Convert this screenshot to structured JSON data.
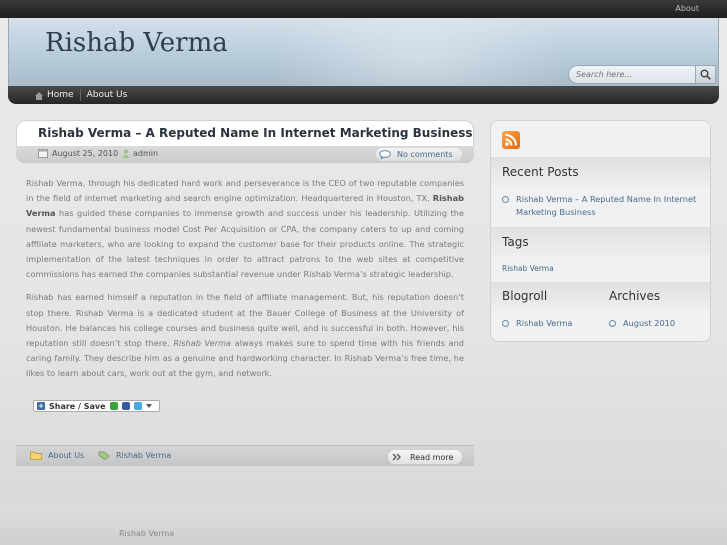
{
  "topbar": {
    "about": "About"
  },
  "header": {
    "site_title": "Rishab Verma",
    "search_placeholder": "Search here..."
  },
  "nav": {
    "items": [
      {
        "label": "Home"
      },
      {
        "label": "About Us"
      }
    ]
  },
  "post": {
    "title": "Rishab Verma – A Reputed Name In Internet Marketing Business",
    "date": "August 25, 2010",
    "author": "admin",
    "comments": "No comments",
    "p1_a": "Rishab Verma, through his dedicated hard work and perseverance is the CEO of two reputable companies in the field of internet marketing and search engine optimization. Headquartered in Houston, TX, ",
    "p1_bold": "Rishab Verma",
    "p1_b": " has guided these companies to immense growth and success under his leadership. Utilizing the newest fundamental business model Cost Per Acquisition or CPA, the company caters to up and coming affiliate marketers, who are looking to expand the customer base for their products online. The strategic implementation of the latest techniques in order to attract patrons to the web sites at competitive commissions has earned the companies substantial revenue under Rishab Verma’s strategic leadership.",
    "p2_a": "Rishab has earned himself a reputation in the field of affiliate management. But, his reputation doesn’t stop there. Rishab Verma is a dedicated student at the Bauer College of Business at the University of Houston. He balances his college courses and business quite well, and is successful in both. However, his reputation still doesn’t stop there. ",
    "p2_italic": "Rishab Verma",
    "p2_b": " always makes sure to spend time with his friends and caring family. They describe him as a genuine and hardworking character. In Rishab Verma’s free time, he likes to learn about cars, work out at the gym, and network.",
    "share_label": "Share / Save",
    "category": "About Us",
    "tag": "Rishab Verma",
    "read_more": "Read more"
  },
  "sidebar": {
    "recent_posts_heading": "Recent Posts",
    "recent_posts": [
      "Rishab Verma – A Reputed Name In Internet Marketing Business"
    ],
    "tags_heading": "Tags",
    "tags": [
      "Rishab Verma"
    ],
    "blogroll_heading": "Blogroll",
    "blogroll": [
      "Rishab Verma"
    ],
    "archives_heading": "Archives",
    "archives": [
      "August 2010"
    ]
  },
  "footer": {
    "text": "Rishab Verma"
  },
  "colors": {
    "accent": "#4a6a8a",
    "nav_bg": "#262626",
    "header_bg": "#bdd0de",
    "rss": "#e26a10"
  }
}
